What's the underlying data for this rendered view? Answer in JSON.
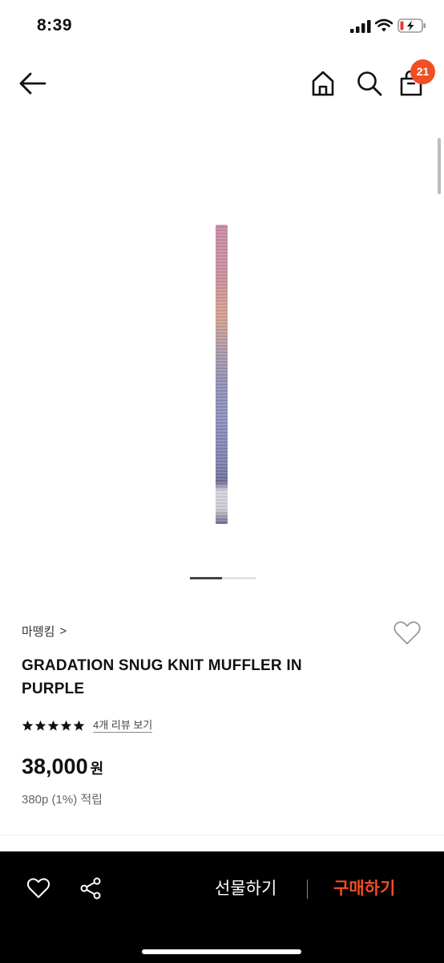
{
  "status_bar": {
    "time": "8:39",
    "battery_state": "charging-low"
  },
  "header": {
    "back_icon": "arrow-left-icon",
    "home_icon": "home-icon",
    "search_icon": "search-icon",
    "cart_icon": "shopping-bag-icon",
    "cart_count": "21"
  },
  "gallery": {
    "page_index": 1,
    "page_count": 2
  },
  "product": {
    "brand": "마뗑킴",
    "brand_chevron": ">",
    "title": "GRADATION SNUG KNIT MUFFLER IN PURPLE",
    "rating_stars": 5,
    "review_link": "4개 리뷰 보기",
    "price": "38,000",
    "currency": "원",
    "points": "380p (1%) 적립"
  },
  "bottom_bar": {
    "gift_label": "선물하기",
    "buy_label": "구매하기",
    "buy_color": "#f04e23"
  },
  "colors": {
    "accent": "#f04e23",
    "bar_background": "#000000"
  }
}
